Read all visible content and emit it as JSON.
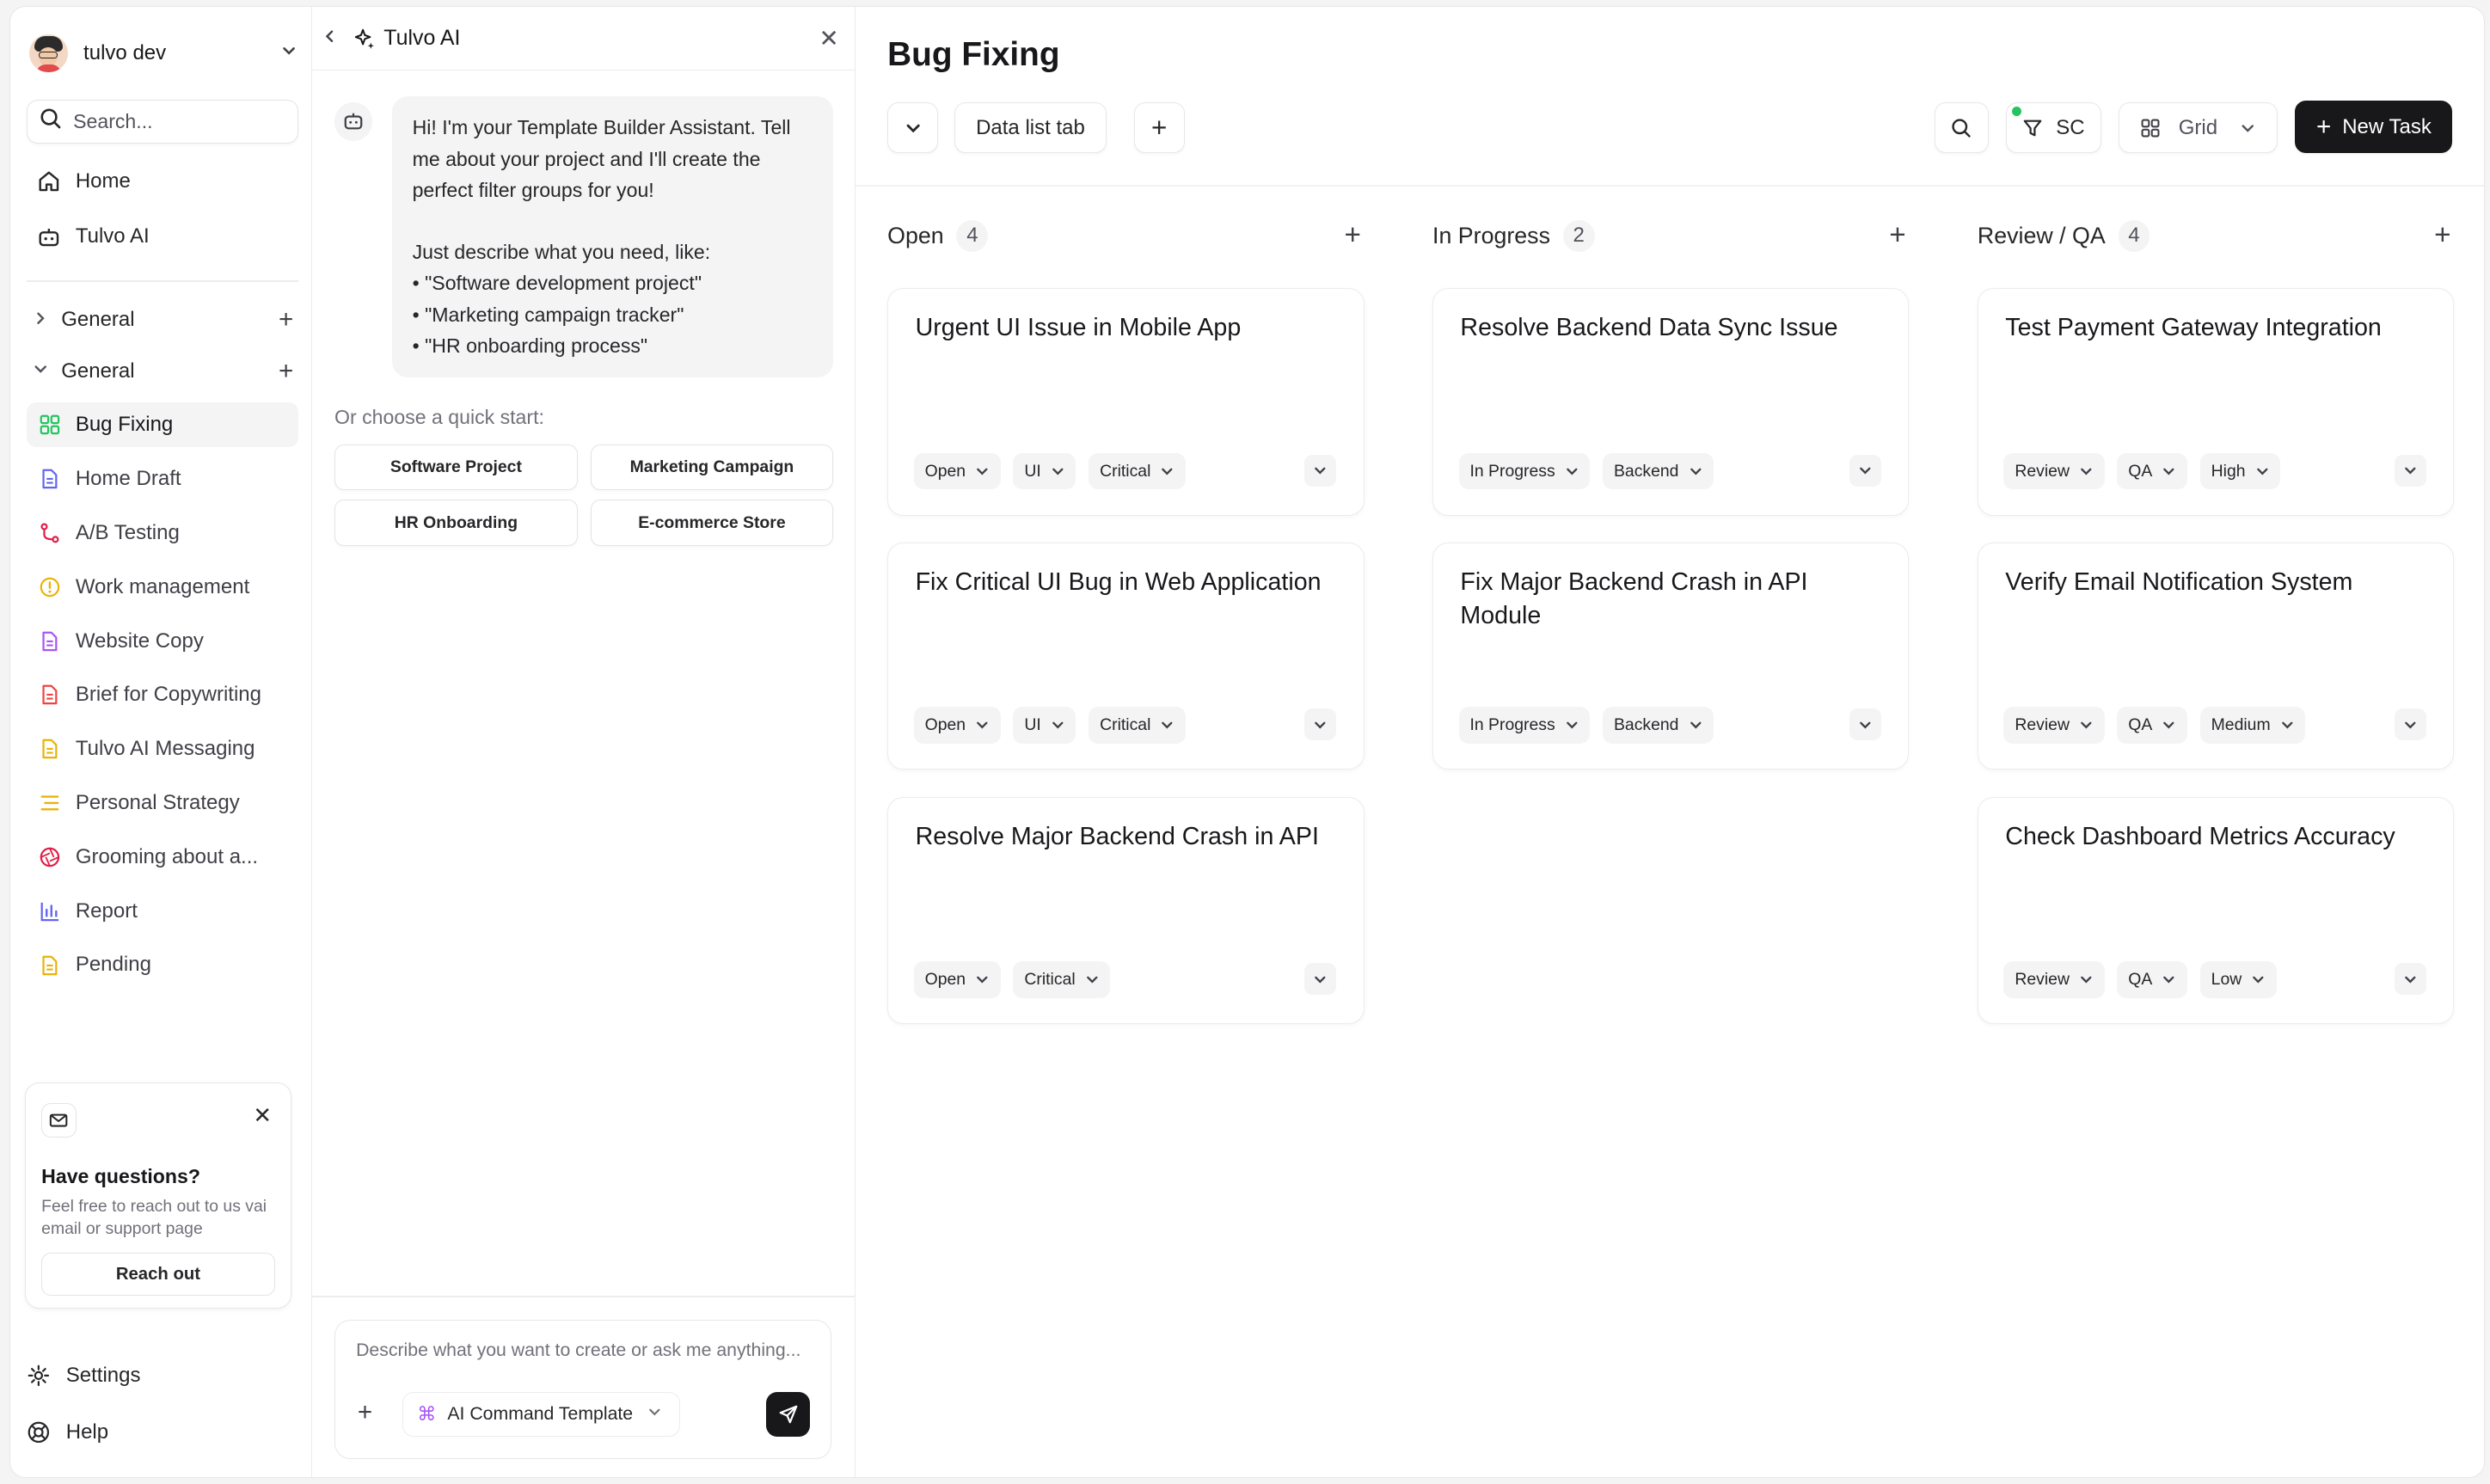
{
  "user": {
    "name": "tulvo dev"
  },
  "sidebar": {
    "search_placeholder": "Search...",
    "nav": [
      {
        "label": "Home",
        "icon": "home-icon"
      },
      {
        "label": "Tulvo AI",
        "icon": "bot-icon"
      }
    ],
    "groups": [
      {
        "label": "General",
        "expanded": false
      },
      {
        "label": "General",
        "expanded": true
      }
    ],
    "pages": [
      {
        "label": "Bug Fixing",
        "icon": "grid-icon",
        "color": "#22c55e",
        "active": true
      },
      {
        "label": "Home Draft",
        "icon": "document-icon",
        "color": "#6366f1"
      },
      {
        "label": "A/B Testing",
        "icon": "branch-icon",
        "color": "#e11d48"
      },
      {
        "label": "Work management",
        "icon": "alert-circle-icon",
        "color": "#eab308"
      },
      {
        "label": "Website Copy",
        "icon": "document-icon",
        "color": "#a855f7"
      },
      {
        "label": "Brief for Copywriting",
        "icon": "document-icon",
        "color": "#ef4444"
      },
      {
        "label": "Tulvo AI Messaging",
        "icon": "document-icon",
        "color": "#eab308"
      },
      {
        "label": "Personal Strategy",
        "icon": "list-icon",
        "color": "#eab308"
      },
      {
        "label": "Grooming about a...",
        "icon": "aperture-icon",
        "color": "#e11d48"
      },
      {
        "label": "Report",
        "icon": "bar-chart-icon",
        "color": "#6366f1"
      },
      {
        "label": "Pending",
        "icon": "document-icon",
        "color": "#eab308"
      }
    ],
    "help_card": {
      "title": "Have questions?",
      "text": "Feel free to reach out to us vai email or support page",
      "button": "Reach out"
    },
    "settings_label": "Settings",
    "help_label": "Help"
  },
  "ai_panel": {
    "title": "Tulvo AI",
    "message_intro": "Hi! I'm your Template Builder Assistant. Tell me about your project and I'll create the perfect filter groups for you!",
    "message_prompt": "Just describe what you need, like:",
    "examples": [
      "\"Software development project\"",
      "\"Marketing campaign tracker\"",
      "\"HR onboarding process\""
    ],
    "quick_start_label": "Or choose a quick start:",
    "quick_starts": [
      "Software Project",
      "Marketing Campaign",
      "HR Onboarding",
      "E-commerce Store"
    ],
    "input_placeholder": "Describe what you want to create or ask me anything...",
    "template_label": "AI Command Template"
  },
  "board": {
    "title": "Bug Fixing",
    "tab_label": "Data list tab",
    "filter_label": "SC",
    "view_label": "Grid",
    "new_task_label": "New Task",
    "accent": "#18181b",
    "columns": [
      {
        "name": "Open",
        "count": "4",
        "cards": [
          {
            "title": "Urgent UI Issue in Mobile App",
            "tags": [
              "Open",
              "UI",
              "Critical"
            ]
          },
          {
            "title": "Fix Critical UI Bug in Web Application",
            "tags": [
              "Open",
              "UI",
              "Critical"
            ]
          },
          {
            "title": "Resolve Major Backend Crash in API",
            "tags": [
              "Open",
              "Critical"
            ]
          }
        ]
      },
      {
        "name": "In Progress",
        "count": "2",
        "cards": [
          {
            "title": "Resolve Backend Data Sync Issue",
            "tags": [
              "In Progress",
              "Backend"
            ]
          },
          {
            "title": "Fix Major Backend Crash in API Module",
            "tags": [
              "In Progress",
              "Backend"
            ]
          }
        ]
      },
      {
        "name": "Review / QA",
        "count": "4",
        "cards": [
          {
            "title": "Test Payment Gateway Integration",
            "tags": [
              "Review",
              "QA",
              "High"
            ]
          },
          {
            "title": "Verify Email Notification System",
            "tags": [
              "Review",
              "QA",
              "Medium"
            ]
          },
          {
            "title": "Check Dashboard Metrics Accuracy",
            "tags": [
              "Review",
              "QA",
              "Low"
            ]
          }
        ]
      }
    ]
  }
}
